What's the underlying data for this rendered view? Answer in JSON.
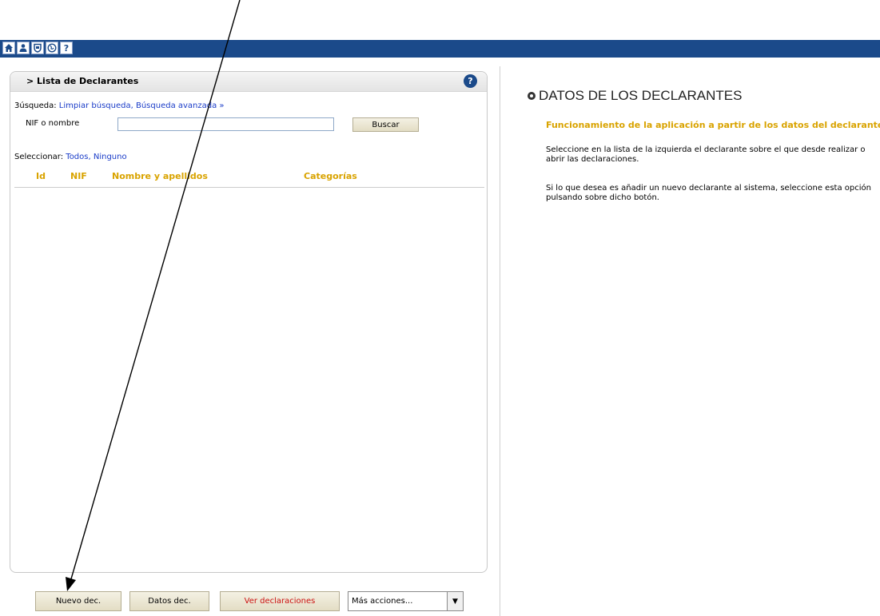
{
  "toolbar": {
    "icons": [
      "home-icon",
      "user-icon",
      "shield-icon",
      "globe-icon",
      "help-icon"
    ],
    "help_glyph": "?"
  },
  "panel": {
    "title": "> Lista de Declarantes",
    "help_glyph": "?"
  },
  "search": {
    "label": "Búsqueda: ",
    "label_clipped": "3úsqueda: ",
    "clear_link": "Limpiar búsqueda",
    "separator": ", ",
    "advanced_link": "Búsqueda avanzada »",
    "field_label": "NIF o nombre",
    "field_value": "",
    "button": "Buscar"
  },
  "select_line": {
    "label": "Seleccionar: ",
    "all": "Todos",
    "separator": ", ",
    "none": "Ninguno"
  },
  "table": {
    "columns": [
      "Id",
      "NIF",
      "Nombre y apellidos",
      "Categorías"
    ],
    "rows": []
  },
  "actions": {
    "new": "Nuevo dec.",
    "data": "Datos dec.",
    "view": "Ver declaraciones",
    "more": "Más acciones..."
  },
  "info": {
    "title": "DATOS DE LOS DECLARANTES",
    "subtitle": "Funcionamiento de la aplicación a partir de los datos del declarante",
    "para1": "Seleccione en la lista de la izquierda el declarante sobre el que desde realizar o abrir las declaraciones.",
    "para2": "Si lo que desea es añadir un nuevo declarante al sistema, seleccione esta opción pulsando sobre dicho botón."
  },
  "colors": {
    "nav_bar": "#1b4a8a",
    "column_header": "#d9a300",
    "link": "#1a3cc8",
    "view_button_text": "#cc1111"
  }
}
